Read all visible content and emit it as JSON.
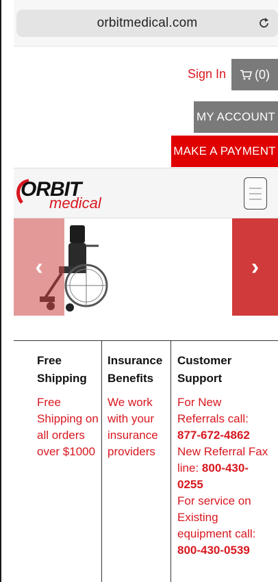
{
  "browser": {
    "url": "orbitmedical.com",
    "reload_icon": "reload-icon"
  },
  "header": {
    "sign_in": "Sign In",
    "cart_label": "(0)",
    "cart_icon": "cart-icon",
    "my_account": "MY ACCOUNT",
    "make_payment": "MAKE A PAYMENT"
  },
  "navbar": {
    "logo_orbit": "ORBIT",
    "logo_medical": "medical",
    "menu_icon": "hamburger-menu-icon"
  },
  "carousel": {
    "prev": "‹",
    "next": "›",
    "slide_alt_icon": "wheelchair-image"
  },
  "features": [
    {
      "title_line1": "Free",
      "title_line2": "Shipping",
      "text_lines": [
        "Free",
        "Shipping on",
        "all orders",
        "over $1000"
      ]
    },
    {
      "title_line1": "Insurance",
      "title_line2": "Benefits",
      "text_lines": [
        "We work",
        "with your",
        "insurance",
        "providers"
      ]
    },
    {
      "title_line1": "Customer",
      "title_line2": "Support",
      "line1": "For New",
      "line2": "Referrals call:",
      "phone1": "877-672-4862",
      "line3": "New Referral Fax",
      "line4_prefix": "line: ",
      "phone2_part1": "800-430-",
      "phone2_part2": "0255",
      "line5": "For service on",
      "line6": "Existing",
      "line7": "equipment call:",
      "phone3": "800-430-0539"
    }
  ],
  "colors": {
    "brand_red": "#d8171f",
    "button_gray": "#7a7a7a",
    "payment_red": "#e00000"
  }
}
